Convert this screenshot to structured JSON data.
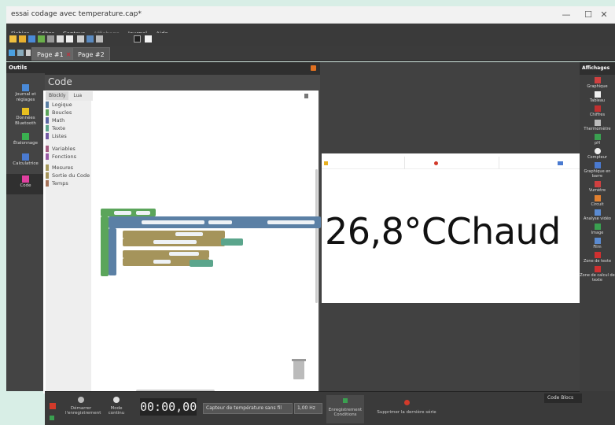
{
  "window": {
    "title": "essai codage avec temperature.cap*",
    "controls": [
      "—",
      "☐",
      "✕"
    ]
  },
  "menu": [
    "Fichier",
    "Editer",
    "Capteur",
    "Affichage",
    "Journal",
    "Aide"
  ],
  "tabs": [
    {
      "label": "Page #1",
      "close": "✕"
    },
    {
      "label": "Page #2"
    }
  ],
  "left_panel": {
    "title": "Outils",
    "items": [
      {
        "label": "Journal et réglages",
        "icon": "journal-icon"
      },
      {
        "label": "Données Bluetooth",
        "icon": "bluetooth-icon"
      },
      {
        "label": "Étalonnage",
        "icon": "calibration-icon"
      },
      {
        "label": "Calculatrice",
        "icon": "calculator-icon"
      },
      {
        "label": "Code",
        "icon": "code-icon"
      }
    ]
  },
  "code_window": {
    "title": "Code",
    "tabs": [
      "Blockly",
      "Lua"
    ],
    "categories": [
      {
        "label": "Logique",
        "color": "#5b80a5"
      },
      {
        "label": "Boucles",
        "color": "#5ba55b"
      },
      {
        "label": "Math",
        "color": "#5b67a5"
      },
      {
        "label": "Texte",
        "color": "#5ba58c"
      },
      {
        "label": "Listes",
        "color": "#745ba5"
      },
      {
        "label": "Variables",
        "color": "#a55b80"
      },
      {
        "label": "Fonctions",
        "color": "#995ba5"
      },
      {
        "label": "Mesures",
        "color": "#a5995b"
      },
      {
        "label": "Sortie du Code",
        "color": "#a5945b"
      },
      {
        "label": "Temps",
        "color": "#a5745b"
      }
    ]
  },
  "display": {
    "value_text": "26,8°CChaud"
  },
  "right_panel": {
    "title": "Affichages",
    "items": [
      {
        "label": "Graphique",
        "icon": "chart-icon"
      },
      {
        "label": "Tableau",
        "icon": "table-icon"
      },
      {
        "label": "Chiffres",
        "icon": "digits-icon"
      },
      {
        "label": "Thermomètre",
        "icon": "thermometer-icon"
      },
      {
        "label": "pH",
        "icon": "ph-icon"
      },
      {
        "label": "Compteur",
        "icon": "counter-icon"
      },
      {
        "label": "Graphique en barre",
        "icon": "bar-chart-icon"
      },
      {
        "label": "Vumètre",
        "icon": "vumeter-icon"
      },
      {
        "label": "Circuit",
        "icon": "circuit-icon"
      },
      {
        "label": "Analyse vidéo",
        "icon": "video-icon"
      },
      {
        "label": "Image",
        "icon": "image-icon"
      },
      {
        "label": "Film",
        "icon": "film-icon"
      },
      {
        "label": "Zone de texte",
        "icon": "text-zone-icon"
      },
      {
        "label": "Zone de calcul de texte",
        "icon": "calc-zone-icon"
      }
    ]
  },
  "bottom": {
    "record_label": "Démarrer l'enregistrement",
    "mode_label": "Mode continu",
    "timer": "00:00,00",
    "sensor": "Capteur de température sans fil",
    "rate": "1,00 Hz",
    "conditions_label": "Enregistrement Conditions",
    "delete_label": "Supprimer la dernière série",
    "console": "Code Blocs"
  },
  "colors": {
    "accent": "#d23a2a",
    "block_green": "#5ba55b",
    "block_blue": "#5b80a5",
    "block_tan": "#a5945b",
    "block_teal": "#5ba58c"
  }
}
